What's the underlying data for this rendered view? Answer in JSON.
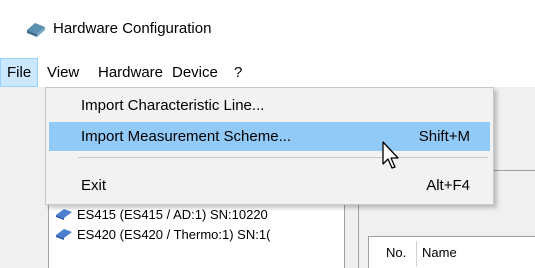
{
  "window": {
    "title": "Hardware Configuration",
    "icon": "hardware-config-icon"
  },
  "menubar": {
    "items": [
      {
        "label": "File",
        "active": true
      },
      {
        "label": "View"
      },
      {
        "label": "Hardware"
      },
      {
        "label": "Device"
      },
      {
        "label": "?"
      }
    ]
  },
  "file_menu": {
    "items": [
      {
        "label": "Import Characteristic Line...",
        "shortcut": ""
      },
      {
        "label": "Import Measurement Scheme...",
        "shortcut": "Shift+M",
        "highlighted": true
      },
      {
        "label": "Exit",
        "shortcut": "Alt+F4"
      }
    ]
  },
  "tree": {
    "items": [
      {
        "label": "ES415 (ES415 / AD:1) SN:10220",
        "icon": "device-module-icon"
      },
      {
        "label": "ES420 (ES420 / Thermo:1) SN:1(",
        "icon": "device-module-icon"
      }
    ]
  },
  "table": {
    "columns": [
      "No.",
      "Name"
    ]
  },
  "colors": {
    "highlight": "#91c9f7",
    "menu_active": "#cce8ff"
  }
}
